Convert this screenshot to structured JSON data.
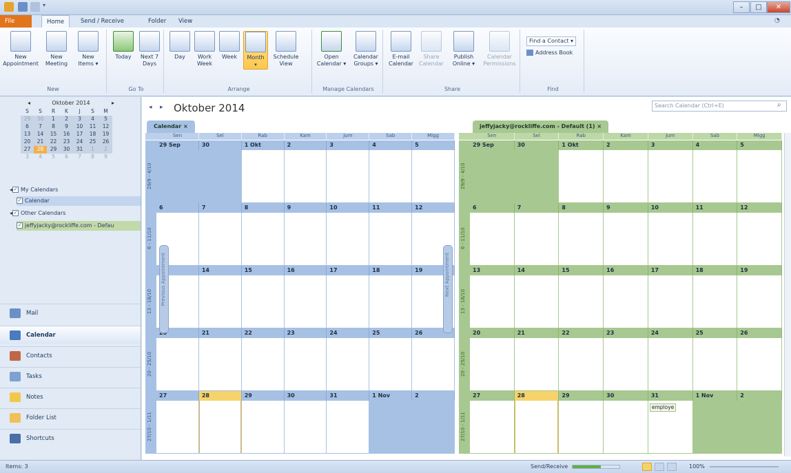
{
  "ribbon_tabs": [
    "File",
    "Home",
    "Send / Receive",
    "Folder",
    "View"
  ],
  "ribbon": {
    "new_group": {
      "label": "New",
      "new_appointment": "New\nAppointment",
      "new_meeting": "New\nMeeting",
      "new_items": "New\nItems ▾"
    },
    "goto_group": {
      "label": "Go To",
      "today": "Today",
      "next7": "Next 7\nDays"
    },
    "arrange_group": {
      "label": "Arrange",
      "day": "Day",
      "work_week": "Work\nWeek",
      "week": "Week",
      "month": "Month",
      "schedule_view": "Schedule\nView"
    },
    "manage_group": {
      "label": "Manage Calendars",
      "open_calendar": "Open\nCalendar ▾",
      "calendar_groups": "Calendar\nGroups ▾"
    },
    "share_group": {
      "label": "Share",
      "email_calendar": "E-mail\nCalendar",
      "share_calendar": "Share\nCalendar",
      "publish_online": "Publish\nOnline ▾",
      "calendar_permissions": "Calendar\nPermissions"
    },
    "find_group": {
      "label": "Find",
      "find_contact": "Find a Contact ▾",
      "address_book": "Address Book"
    }
  },
  "minical": {
    "month": "Oktober 2014",
    "days": [
      "S",
      "S",
      "R",
      "K",
      "J",
      "S",
      "M"
    ],
    "rows": [
      [
        "29",
        "30",
        "1",
        "2",
        "3",
        "4",
        "5"
      ],
      [
        "6",
        "7",
        "8",
        "9",
        "10",
        "11",
        "12"
      ],
      [
        "13",
        "14",
        "15",
        "16",
        "17",
        "18",
        "19"
      ],
      [
        "20",
        "21",
        "22",
        "23",
        "24",
        "25",
        "26"
      ],
      [
        "27",
        "28",
        "29",
        "30",
        "31",
        "1",
        "2"
      ],
      [
        "3",
        "4",
        "5",
        "6",
        "7",
        "8",
        "9"
      ]
    ]
  },
  "tree": {
    "my_calendars": "My Calendars",
    "calendar": "Calendar",
    "other_calendars": "Other Calendars",
    "shared": "jeffyjacky@rockliffe.com - Defau"
  },
  "nav": [
    "Mail",
    "Calendar",
    "Contacts",
    "Tasks",
    "Notes",
    "Folder List",
    "Shortcuts"
  ],
  "cal_title": "Oktober 2014",
  "search_placeholder": "Search Calendar (Ctrl+E)",
  "left_pane": {
    "tab": "Calendar",
    "headers": [
      "Sen",
      "Sel",
      "Rab",
      "Kam",
      "Jum",
      "Sab",
      "Migg"
    ],
    "weeks": [
      {
        "label": "29/9 - 4/10",
        "days": [
          "29 Sep",
          "30",
          "1 Okt",
          "2",
          "3",
          "4",
          "5"
        ]
      },
      {
        "label": "6 - 11/10",
        "days": [
          "6",
          "7",
          "8",
          "9",
          "10",
          "11",
          "12"
        ]
      },
      {
        "label": "13 - 18/10",
        "days": [
          "13",
          "14",
          "15",
          "16",
          "17",
          "18",
          "19"
        ]
      },
      {
        "label": "20 - 25/10",
        "days": [
          "20",
          "21",
          "22",
          "23",
          "24",
          "25",
          "26"
        ]
      },
      {
        "label": "27/10 - 1/11",
        "days": [
          "27",
          "28",
          "29",
          "30",
          "31",
          "1 Nov",
          "2"
        ]
      }
    ],
    "prev_appt": "Previous Appointment",
    "next_appt": "Next Appointment"
  },
  "right_pane": {
    "tab": "jeffyjacky@rockliffe.com - Default (1)",
    "headers": [
      "Sen",
      "Sel",
      "Rab",
      "Kam",
      "Jum",
      "Sab",
      "Migg"
    ],
    "weeks": [
      {
        "label": "29/9 - 4/10",
        "days": [
          "29 Sep",
          "30",
          "1 Okt",
          "2",
          "3",
          "4",
          "5"
        ]
      },
      {
        "label": "6 - 11/10",
        "days": [
          "6",
          "7",
          "8",
          "9",
          "10",
          "11",
          "12"
        ]
      },
      {
        "label": "13 - 18/10",
        "days": [
          "13",
          "14",
          "15",
          "16",
          "17",
          "18",
          "19"
        ]
      },
      {
        "label": "20 - 25/10",
        "days": [
          "20",
          "21",
          "22",
          "23",
          "24",
          "25",
          "26"
        ]
      },
      {
        "label": "27/10 - 1/11",
        "days": [
          "27",
          "28",
          "29",
          "30",
          "31",
          "1 Nov",
          "2"
        ]
      }
    ],
    "event": "employe"
  },
  "status": {
    "items": "Items: 3",
    "send_receive": "Send/Receive",
    "zoom": "100%"
  },
  "colors": {
    "blue_bar": "#a7c1e4",
    "green_bar": "#a7c890",
    "today": "#f6d36a",
    "file_tab": "#e1741d"
  }
}
